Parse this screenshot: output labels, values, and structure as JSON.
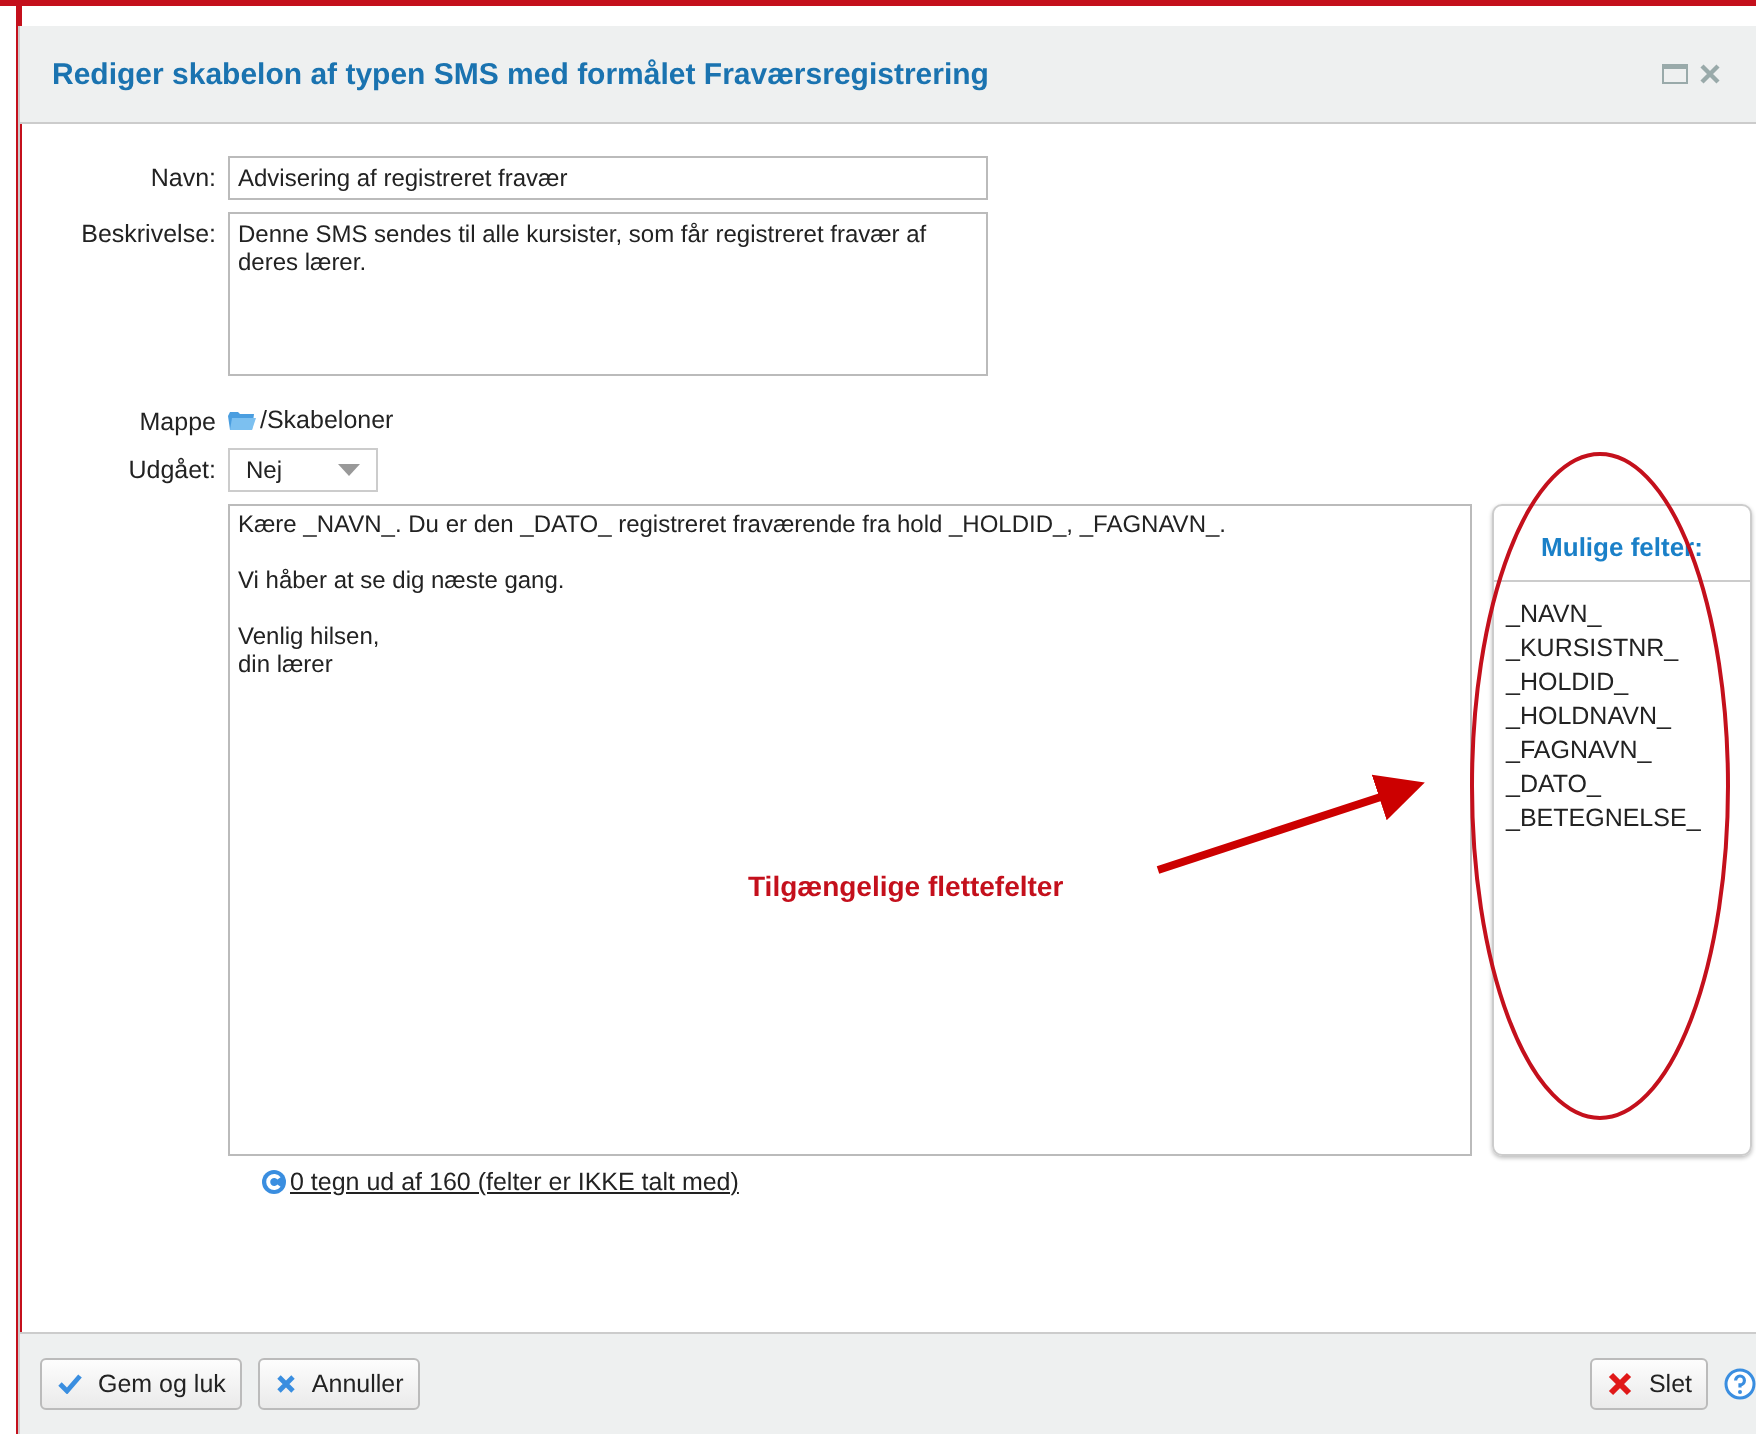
{
  "window": {
    "title": "Rediger skabelon af typen SMS med formålet Fraværsregistrering"
  },
  "form": {
    "name_label": "Navn:",
    "name_value": "Advisering af registreret fravær",
    "description_label": "Beskrivelse:",
    "description_value": "Denne SMS sendes til alle kursister, som får registreret fravær af deres lærer.",
    "folder_label": "Mappe",
    "folder_value": "/Skabeloner",
    "expired_label": "Udgået:",
    "expired_value": "Nej"
  },
  "message": "Kære _NAVN_. Du er den _DATO_ registreret fraværende fra hold _HOLDID_, _FAGNAVN_.\n\nVi håber at se dig næste gang.\n\nVenlig hilsen,\ndin lærer",
  "fields_panel": {
    "title": "Mulige felter:",
    "fields": [
      "_NAVN_",
      "_KURSISTNR_",
      "_HOLDID_",
      "_HOLDNAVN_",
      "_FAGNAVN_",
      "_DATO_",
      "_BETEGNELSE_"
    ]
  },
  "counter": "0 tegn ud af 160 (felter er IKKE talt med)",
  "annotation": "Tilgængelige flettefelter",
  "buttons": [
    {
      "kind": "save",
      "label": "Gem og luk"
    },
    {
      "kind": "cancel",
      "label": "Annuller"
    },
    {
      "kind": "delete",
      "label": "Slet"
    }
  ]
}
